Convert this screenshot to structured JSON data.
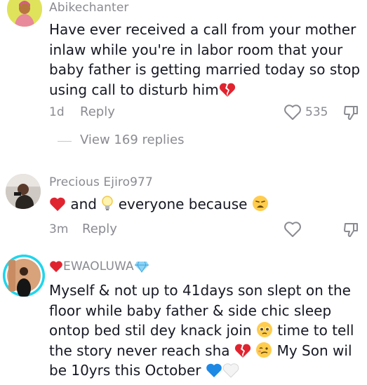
{
  "comments": [
    {
      "username": "Abikechanter",
      "lines": [
        "Have ever received a call from your mother",
        "inlaw while you're in labor room that your",
        "baby father is getting married today so stop",
        "using call to disturb him"
      ],
      "emojis": [
        "broken-heart"
      ],
      "time": "1d",
      "reply_label": "Reply",
      "like_count": "535",
      "view_replies": "View 169 replies"
    },
    {
      "username": "Precious Ejiro977",
      "parts": [
        "and",
        "everyone because"
      ],
      "emojis": [
        "red-heart",
        "light-bulb",
        "weary-face"
      ],
      "time": "3m",
      "reply_label": "Reply"
    },
    {
      "username": "EWAOLUWA",
      "username_emojis": [
        "red-heart",
        "gem"
      ],
      "lines": [
        "Myself & not up to 41days son slept on the",
        "floor while baby father & side chic sleep",
        "ontop bed stil dey knack join",
        "time to tell",
        "the story never reach sha",
        "My Son wil",
        "be 10yrs this October"
      ],
      "emojis": [
        "pleading-face",
        "broken-heart",
        "woozy-face",
        "blue-heart",
        "white-heart"
      ]
    }
  ],
  "colors": {
    "text": "#161823",
    "muted": "#8a8b91",
    "story_ring": "#20d5ec"
  },
  "icons": [
    "heart-outline-icon",
    "dislike-icon"
  ]
}
